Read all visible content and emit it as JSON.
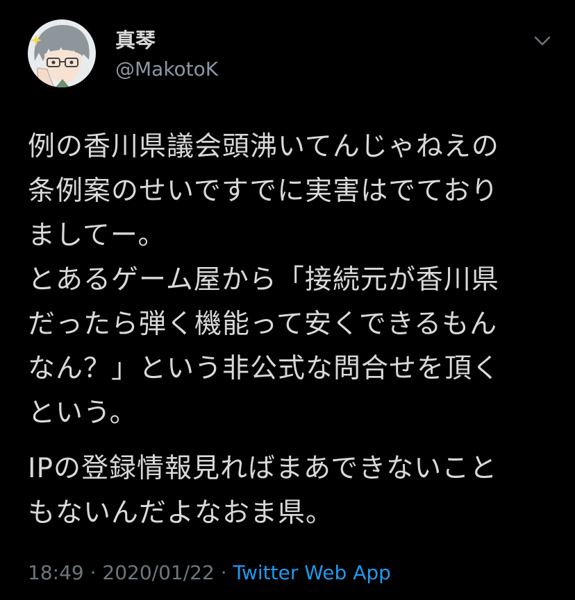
{
  "author": {
    "display_name": "真琴",
    "handle": "@MakotoK",
    "avatar_icon": "anime-avatar-icon",
    "menu_icon": "chevron-down-icon"
  },
  "tweet": {
    "paragraph1": [
      "例の香川県議会頭沸いてんじゃねえの",
      "条例案のせいですでに実害はでており",
      "ましてー。",
      "とあるゲーム屋から「接続元が香川県",
      "だったら弾く機能って安くできるもん",
      "なん？」という非公式な問合せを頂く",
      "という。"
    ],
    "paragraph2": [
      "IPの登録情報見ればまあできないこと",
      "もないんだよなおま県。"
    ]
  },
  "meta": {
    "time": "18:49",
    "sep1": " · ",
    "date": "2020/01/22",
    "sep2": " · ",
    "source": "Twitter Web App"
  },
  "colors": {
    "background": "#000000",
    "text": "#d9d9d9",
    "muted": "#6e767d",
    "link": "#1d9bf0"
  }
}
